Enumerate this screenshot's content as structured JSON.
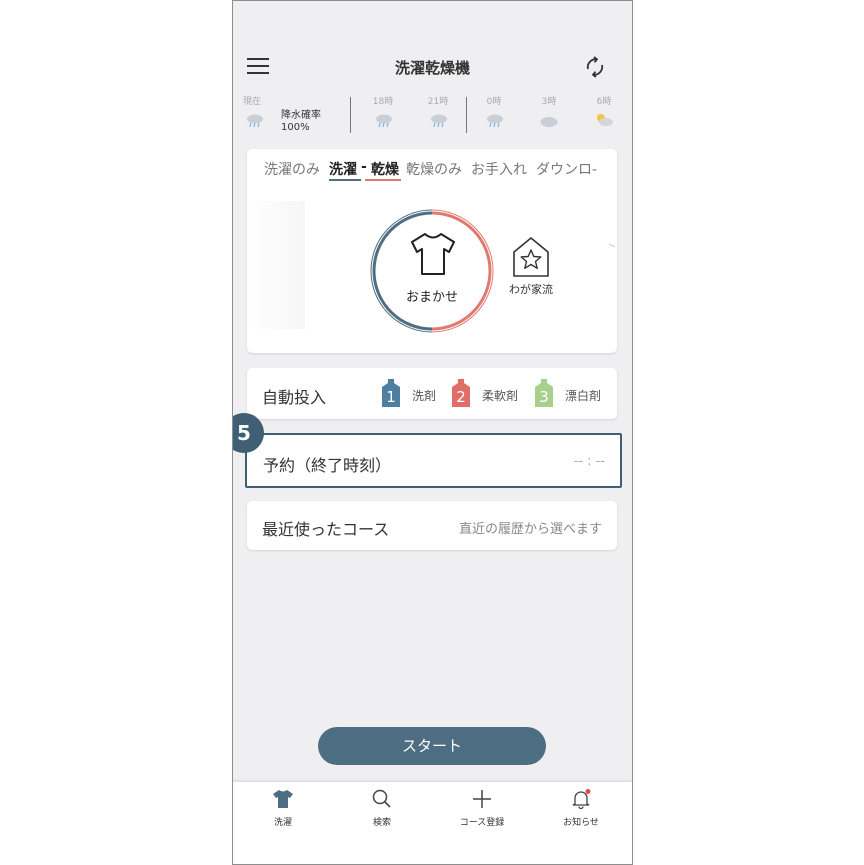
{
  "header": {
    "title": "洗濯乾燥機"
  },
  "weather": {
    "now_label": "現在",
    "precip_label": "降水確率",
    "precip_value": "100%",
    "times": [
      "18時",
      "21時",
      "0時",
      "3時",
      "6時"
    ]
  },
  "course_tabs": [
    "洗濯のみ",
    "洗濯",
    "-",
    "乾燥",
    "乾燥のみ",
    "お手入れ",
    "ダウンロ-"
  ],
  "modes": {
    "omakase": "おまかせ",
    "wagaya": "わが家流"
  },
  "auto_dose": {
    "label": "自動投入",
    "items": [
      {
        "num": "1",
        "label": "洗剤",
        "color": "#4e7fa0"
      },
      {
        "num": "2",
        "label": "柔軟剤",
        "color": "#e06d68"
      },
      {
        "num": "3",
        "label": "漂白剤",
        "color": "#a8d08d"
      }
    ]
  },
  "step_badge": "5",
  "reservation": {
    "label": "予約（終了時刻）",
    "value": "-- : --"
  },
  "recent": {
    "label": "最近使ったコース",
    "value": "直近の履歴から選べます"
  },
  "start_button": "スタート",
  "bottom_nav": [
    {
      "label": "洗濯",
      "icon": "shirt-icon"
    },
    {
      "label": "検索",
      "icon": "search-icon"
    },
    {
      "label": "コース登録",
      "icon": "plus-icon"
    },
    {
      "label": "お知らせ",
      "icon": "bell-icon"
    }
  ],
  "colors": {
    "accent_blue": "#4d6e82",
    "accent_red": "#e07a70",
    "focus_border": "#3f5f75"
  }
}
